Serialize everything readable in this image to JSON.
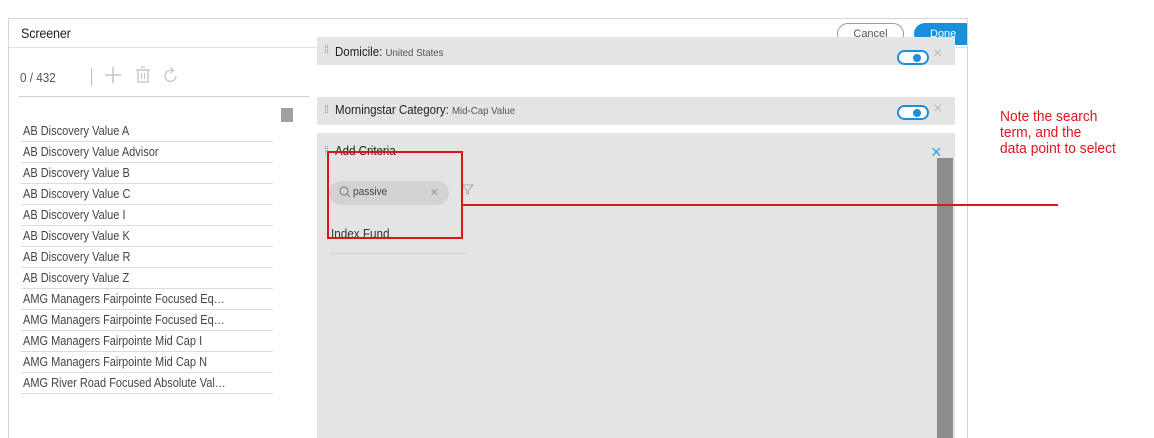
{
  "app": {
    "title": "Screener",
    "cancel_label": "Cancel",
    "done_label": "Done"
  },
  "colors": {
    "accent": "#1a8fdc",
    "callout": "#e0141c",
    "panel_bg": "#e4e4e4"
  },
  "left": {
    "count": "0 / 432",
    "icons": [
      "plus-icon",
      "trash-icon",
      "refresh-icon"
    ],
    "items": [
      "AB Discovery Value A",
      "AB Discovery Value Advisor",
      "AB Discovery Value B",
      "AB Discovery Value C",
      "AB Discovery Value I",
      "AB Discovery Value K",
      "AB Discovery Value R",
      "AB Discovery Value Z",
      "AMG Managers Fairpointe Focused Eq…",
      "AMG Managers Fairpointe Focused Eq…",
      "AMG Managers Fairpointe Mid Cap I",
      "AMG Managers Fairpointe Mid Cap N",
      "AMG River Road Focused Absolute Val…"
    ]
  },
  "criteria": [
    {
      "name": "Domicile:",
      "value": "United States",
      "enabled": true
    },
    {
      "name": "Morningstar Category:",
      "value": "Mid-Cap Value",
      "enabled": true
    }
  ],
  "add_criteria": {
    "label": "Add Criteria",
    "search_value": "passive",
    "results": [
      "Index Fund"
    ]
  },
  "callout": {
    "lines": [
      "Note the search",
      "term, and the",
      "data point to select"
    ]
  }
}
